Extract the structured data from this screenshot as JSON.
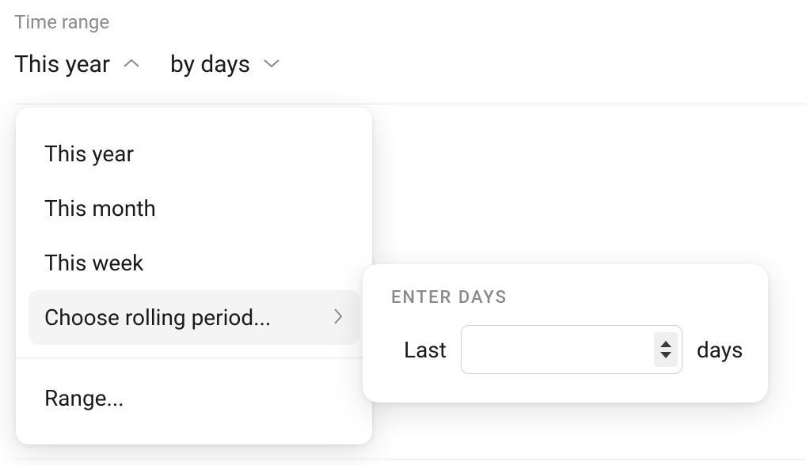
{
  "section": {
    "label": "Time range"
  },
  "selectors": {
    "range": {
      "text": "This year"
    },
    "granularity": {
      "text": "by days"
    }
  },
  "dropdown": {
    "items": [
      {
        "label": "This year"
      },
      {
        "label": "This month"
      },
      {
        "label": "This week"
      },
      {
        "label": "Choose rolling period...",
        "hasSubmenu": true,
        "highlighted": true
      },
      {
        "label": "Range..."
      }
    ]
  },
  "submenu": {
    "title": "ENTER DAYS",
    "prefix": "Last",
    "inputValue": "",
    "suffix": "days"
  }
}
